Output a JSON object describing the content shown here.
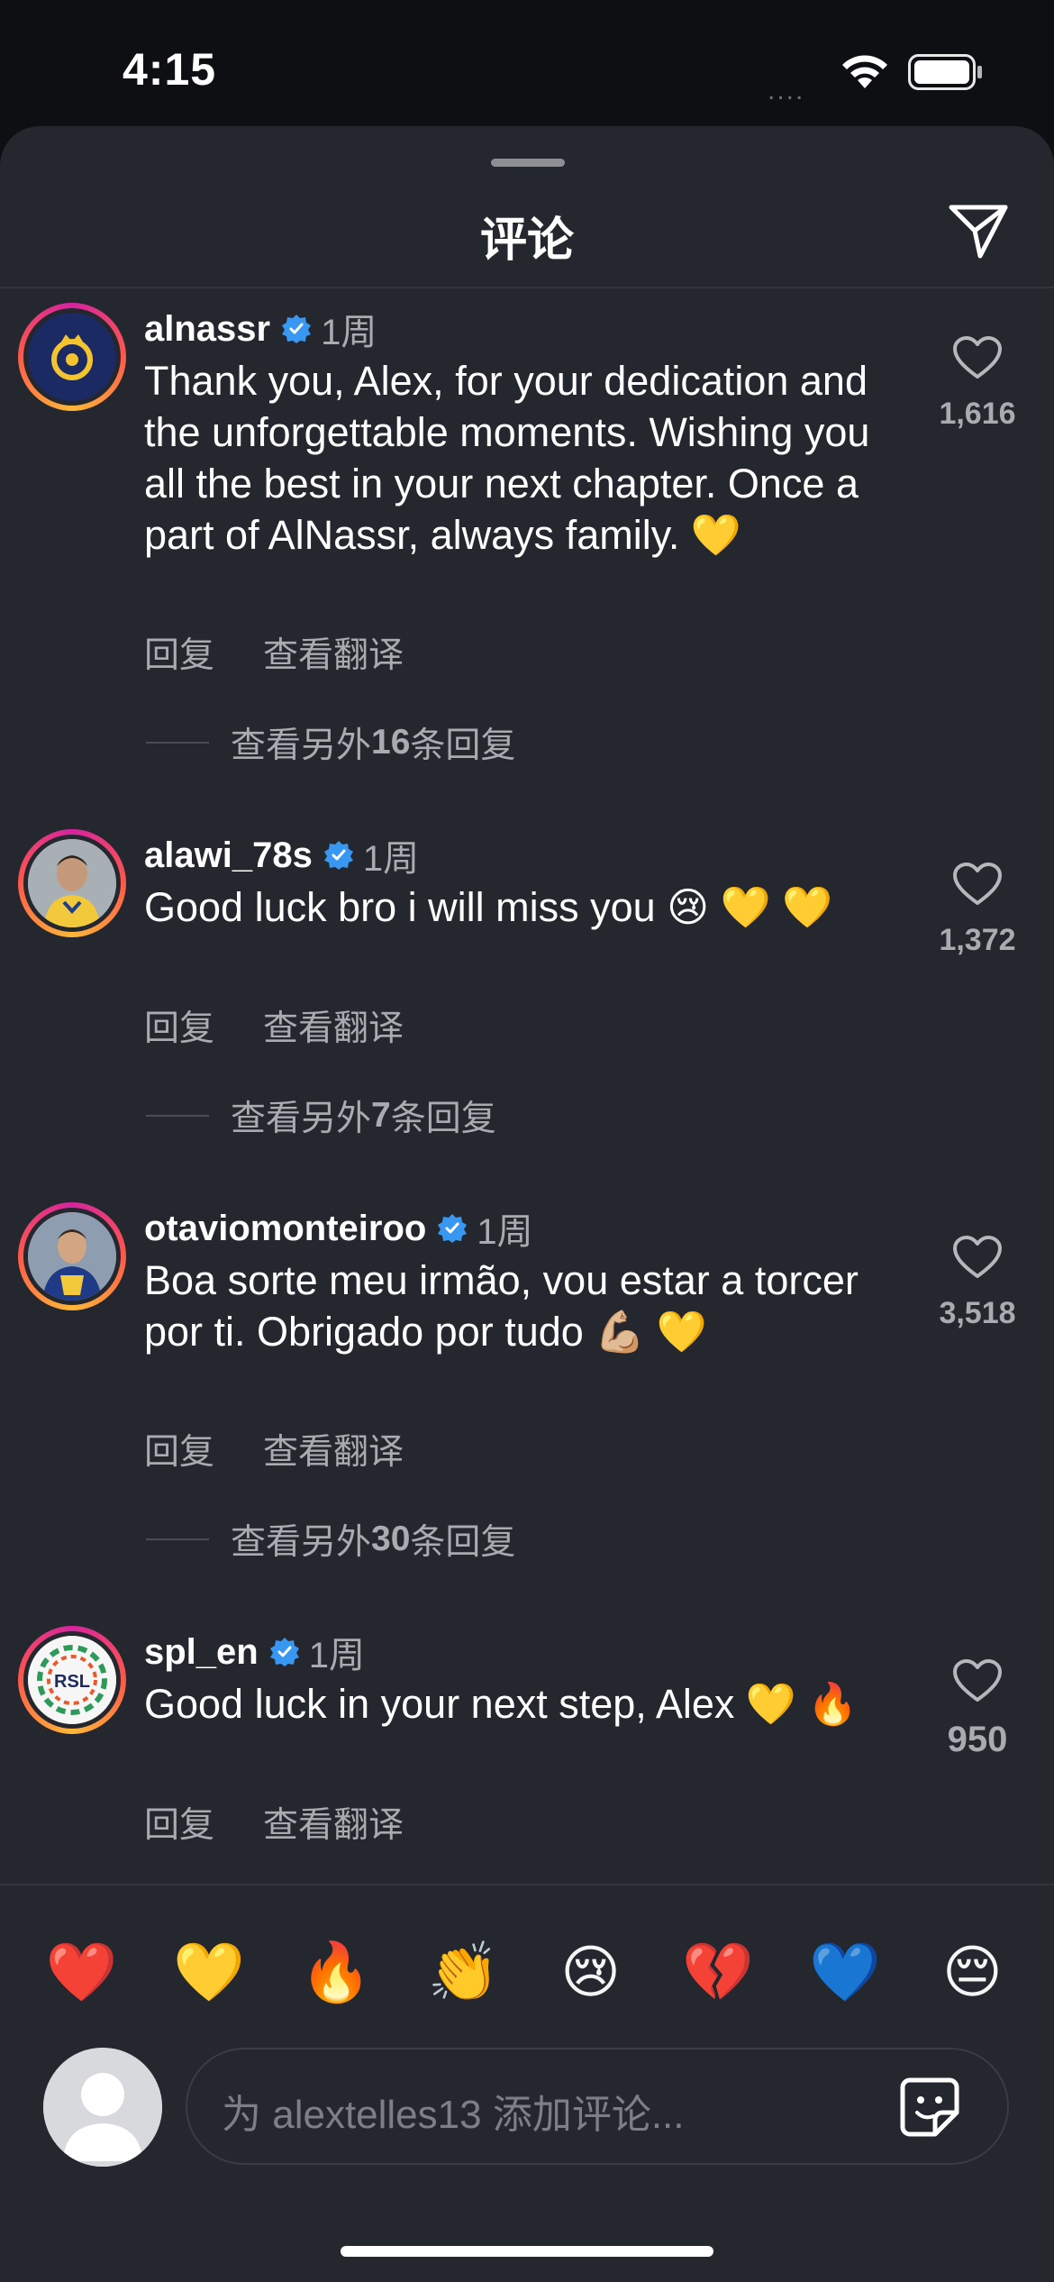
{
  "status": {
    "time": "4:15",
    "signal": "....",
    "icons": [
      "wifi-icon",
      "battery-icon"
    ]
  },
  "sheet": {
    "title": "评论",
    "share_icon": "paper-plane-icon"
  },
  "comments": [
    {
      "username": "alnassr",
      "time": "1周",
      "text": "Thank you, Alex, for your dedication and the unforgettable moments. Wishing you all the best in your next chapter. Once a part of AlNassr, always family. 💛",
      "reply_label": "回复",
      "translate_label": "查看翻译",
      "likes": "1,616",
      "more_replies_prefix": "查看另外",
      "more_replies_count": "16",
      "more_replies_suffix": "条回复"
    },
    {
      "username": "alawi_78s",
      "time": "1周",
      "text": "Good luck bro i will miss you 😢 💛 💛",
      "reply_label": "回复",
      "translate_label": "查看翻译",
      "likes": "1,372",
      "more_replies_prefix": "查看另外",
      "more_replies_count": "7",
      "more_replies_suffix": "条回复"
    },
    {
      "username": "otaviomonteiroo",
      "time": "1周",
      "text": "Boa sorte meu irmão, vou estar a torcer por ti. Obrigado por tudo 💪🏼 💛",
      "reply_label": "回复",
      "translate_label": "查看翻译",
      "likes": "3,518",
      "more_replies_prefix": "查看另外",
      "more_replies_count": "30",
      "more_replies_suffix": "条回复"
    },
    {
      "username": "spl_en",
      "time": "1周",
      "text": "Good luck in your next step, Alex 💛 🔥",
      "reply_label": "回复",
      "translate_label": "查看翻译",
      "likes": "950"
    }
  ],
  "emoji_bar": [
    "❤️",
    "💛",
    "🔥",
    "👏",
    "😢",
    "💔",
    "💙",
    "😔"
  ],
  "input": {
    "placeholder": "为 alextelles13 添加评论..."
  },
  "colors": {
    "accent_blue": "#3897f0",
    "background": "#25272e",
    "muted_text": "#a9abb1"
  }
}
